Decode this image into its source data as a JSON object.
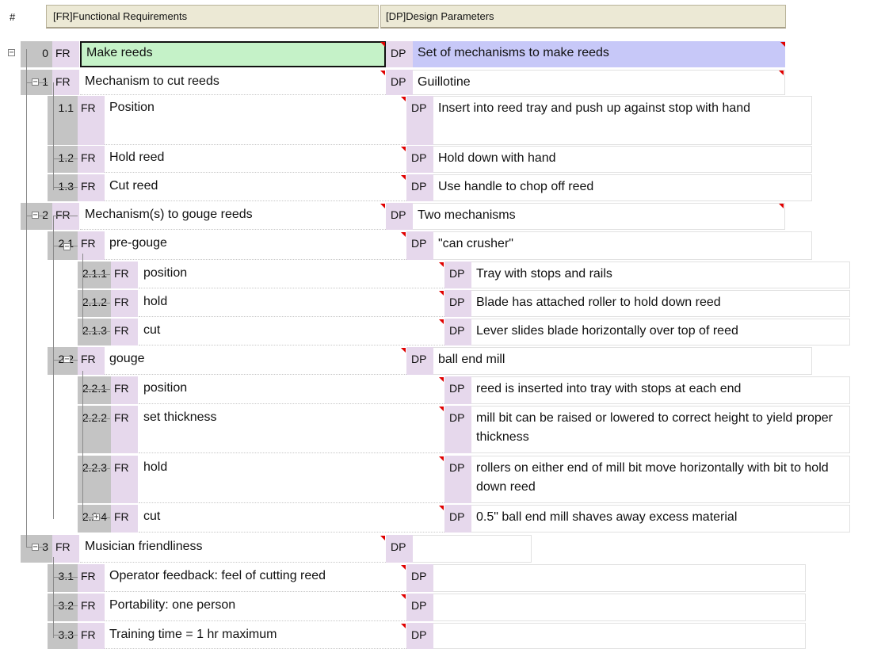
{
  "header": {
    "hash": "#",
    "fr_column": "[FR]Functional Requirements",
    "dp_column": "[DP]Design Parameters"
  },
  "fr_tag": "FR",
  "dp_tag": "DP",
  "colors": {
    "fr_tag_bg": "#e6d8ec",
    "number_bg": "#c4c4c4",
    "selected_fr_bg": "#c5f2c8",
    "root_dp_bg": "#c7c8f8",
    "flag_red": "#e00000"
  },
  "rows": [
    {
      "id": "0",
      "fr": "Make reeds",
      "dp": "Set of mechanisms to make reeds",
      "toggle": "minus-icon",
      "selected": true
    },
    {
      "id": "1",
      "fr": "Mechanism to cut reeds",
      "dp": "Guillotine",
      "toggle": "minus-icon"
    },
    {
      "id": "1.1",
      "fr": "Position",
      "dp": "Insert into reed tray and push up against stop with hand"
    },
    {
      "id": "1.2",
      "fr": "Hold reed",
      "dp": "Hold down with hand"
    },
    {
      "id": "1.3",
      "fr": "Cut reed",
      "dp": "Use handle to chop off reed"
    },
    {
      "id": "2",
      "fr": "Mechanism(s) to gouge reeds",
      "dp": "Two mechanisms",
      "toggle": "minus-icon"
    },
    {
      "id": "2.1",
      "fr": "pre-gouge",
      "dp": "\"can crusher\"",
      "toggle": "minus-icon"
    },
    {
      "id": "2.1.1",
      "fr": "position",
      "dp": "Tray with stops and rails"
    },
    {
      "id": "2.1.2",
      "fr": "hold",
      "dp": "Blade has attached roller to hold down reed"
    },
    {
      "id": "2.1.3",
      "fr": "cut",
      "dp": "Lever slides blade horizontally over top of reed"
    },
    {
      "id": "2.2",
      "fr": "gouge",
      "dp": "ball end mill",
      "toggle": "minus-icon"
    },
    {
      "id": "2.2.1",
      "fr": "position",
      "dp": "reed is inserted into tray with stops at each end"
    },
    {
      "id": "2.2.2",
      "fr": "set thickness",
      "dp": "mill bit can be raised or lowered to correct height to yield proper thickness"
    },
    {
      "id": "2.2.3",
      "fr": "hold",
      "dp": "rollers on either end of mill bit move horizontally with bit to hold down reed"
    },
    {
      "id": "2.2.4",
      "fr": "cut",
      "dp": "0.5\" ball end mill shaves away excess material",
      "toggle": "plus-icon"
    },
    {
      "id": "3",
      "fr": "Musician friendliness",
      "dp": "",
      "toggle": "minus-icon"
    },
    {
      "id": "3.1",
      "fr": "Operator feedback:  feel of cutting reed",
      "dp": ""
    },
    {
      "id": "3.2",
      "fr": "Portability: one person",
      "dp": ""
    },
    {
      "id": "3.3",
      "fr": "Training time = 1 hr maximum",
      "dp": ""
    }
  ]
}
